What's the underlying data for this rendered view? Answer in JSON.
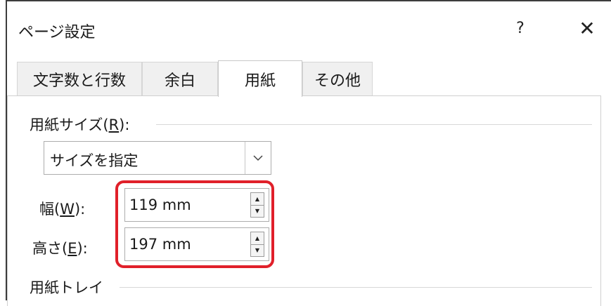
{
  "dialog": {
    "title": "ページ設定",
    "help_label": "?",
    "close_label": "✕"
  },
  "tabs": [
    {
      "label": "文字数と行数",
      "active": false
    },
    {
      "label": "余白",
      "active": false
    },
    {
      "label": "用紙",
      "active": true
    },
    {
      "label": "その他",
      "active": false
    }
  ],
  "paper_size": {
    "label_prefix": "用紙サイズ(",
    "label_key": "R",
    "label_suffix": "):",
    "selected_value": "サイズを指定"
  },
  "width": {
    "label_prefix": "幅(",
    "label_key": "W",
    "label_suffix": "):",
    "value": "119 mm"
  },
  "height": {
    "label_prefix": "高さ(",
    "label_key": "E",
    "label_suffix": "):",
    "value": "197 mm"
  },
  "paper_tray": {
    "label": "用紙トレイ"
  },
  "colors": {
    "highlight": "#e0202a"
  }
}
